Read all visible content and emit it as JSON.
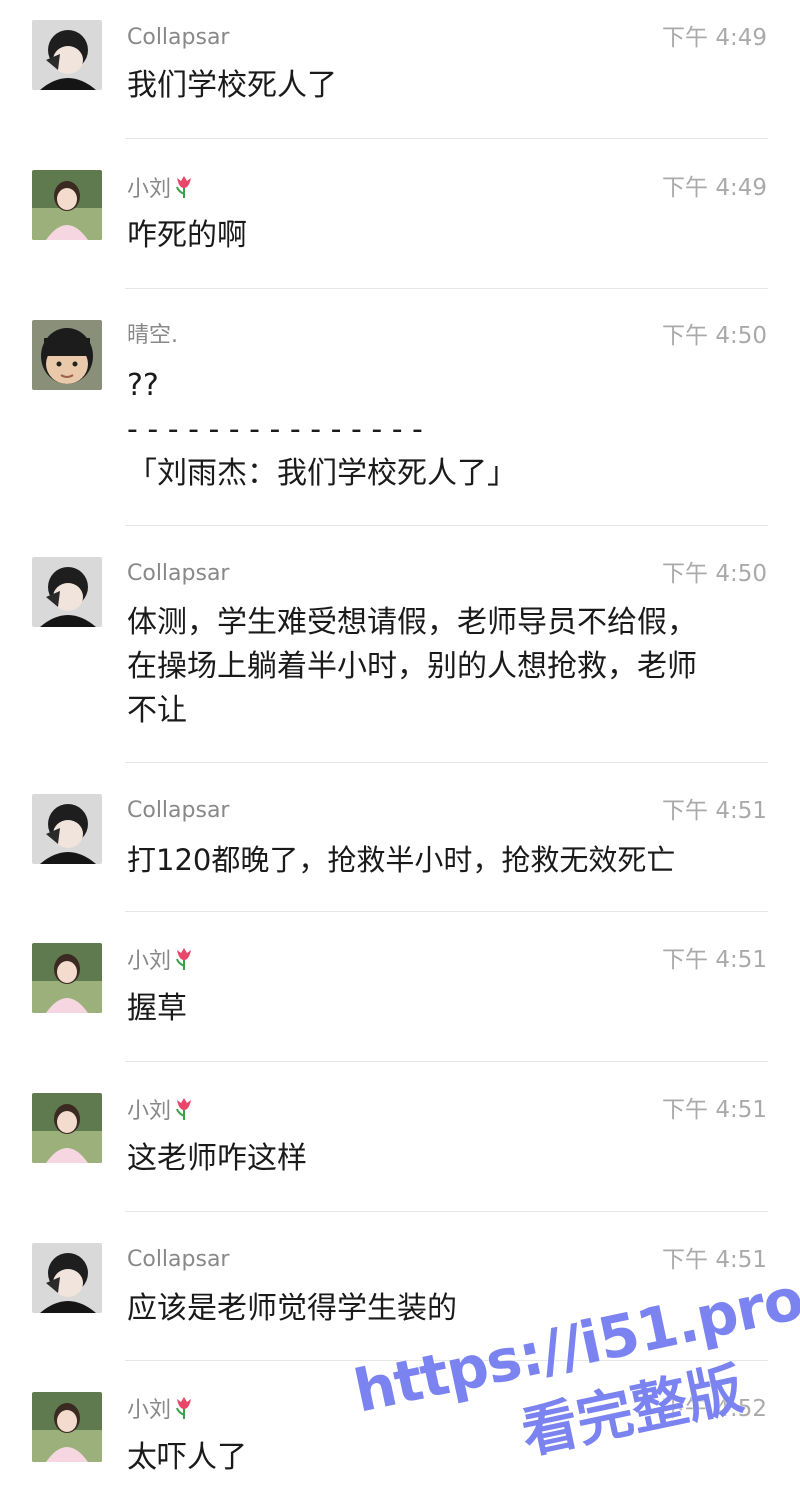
{
  "messages": [
    {
      "name": "Collapsar",
      "time": "下午 4:49",
      "text": "我们学校死人了",
      "avatar": "collapsar-avatar",
      "flower": false
    },
    {
      "name": "小刘",
      "time": "下午 4:49",
      "text": "咋死的啊",
      "avatar": "xiaoliu-avatar",
      "flower": true
    },
    {
      "name": "晴空.",
      "time": "下午 4:50",
      "text": "??\n- - - - - - - - - - - - - - -\n「刘雨杰：我们学校死人了」",
      "avatar": "qingkong-avatar",
      "flower": false
    },
    {
      "name": "Collapsar",
      "time": "下午 4:50",
      "text": "体测，学生难受想请假，老师导员不给假，在操场上躺着半小时，别的人想抢救，老师不让",
      "avatar": "collapsar-avatar",
      "flower": false
    },
    {
      "name": "Collapsar",
      "time": "下午 4:51",
      "text": "打120都晚了，抢救半小时，抢救无效死亡",
      "avatar": "collapsar-avatar",
      "flower": false
    },
    {
      "name": "小刘",
      "time": "下午 4:51",
      "text": "握草",
      "avatar": "xiaoliu-avatar",
      "flower": true
    },
    {
      "name": "小刘",
      "time": "下午 4:51",
      "text": "这老师咋这样",
      "avatar": "xiaoliu-avatar",
      "flower": true
    },
    {
      "name": "Collapsar",
      "time": "下午 4:51",
      "text": "应该是老师觉得学生装的",
      "avatar": "collapsar-avatar",
      "flower": false
    },
    {
      "name": "小刘",
      "time": "下午 4:52",
      "text": "太吓人了",
      "avatar": "xiaoliu-avatar",
      "flower": true
    }
  ],
  "watermark": {
    "url": "https://i51.pro",
    "subtitle": "看完整版",
    "color": "#7b83f0"
  }
}
